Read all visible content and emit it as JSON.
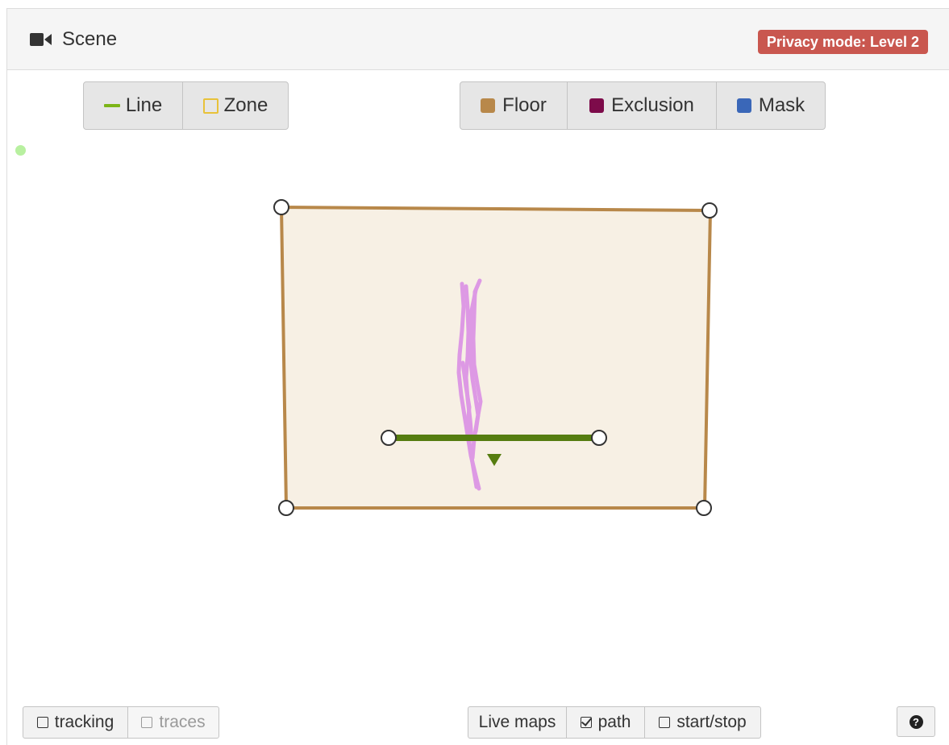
{
  "header": {
    "title": "Scene",
    "icon": "video-camera-icon",
    "privacy_badge": "Privacy mode: Level 2",
    "privacy_color": "#c9574f"
  },
  "drawing_tools": [
    {
      "label": "Line",
      "icon": "line-icon",
      "color": "#7cb518"
    },
    {
      "label": "Zone",
      "icon": "zone-icon",
      "color": "#e8c23a"
    }
  ],
  "area_tools": [
    {
      "label": "Floor",
      "color": "#b8884a"
    },
    {
      "label": "Exclusion",
      "color": "#7d0b4a"
    },
    {
      "label": "Mask",
      "color": "#3a67b8"
    }
  ],
  "status": {
    "color": "#b8f0a0"
  },
  "scene": {
    "floor_fill": "#f7f0e4",
    "floor_stroke": "#b8884a",
    "line_color": "#567d10",
    "path_color": "#dd99e4",
    "handle_fill": "#ffffff",
    "handle_stroke": "#333333"
  },
  "bottom_left": [
    {
      "label": "tracking",
      "checked": false,
      "disabled": false
    },
    {
      "label": "traces",
      "checked": false,
      "disabled": true
    }
  ],
  "bottom_center": {
    "live_maps_label": "Live maps",
    "options": [
      {
        "label": "path",
        "checked": true
      },
      {
        "label": "start/stop",
        "checked": false
      }
    ]
  },
  "help": {
    "icon": "help-icon",
    "glyph": "?"
  }
}
